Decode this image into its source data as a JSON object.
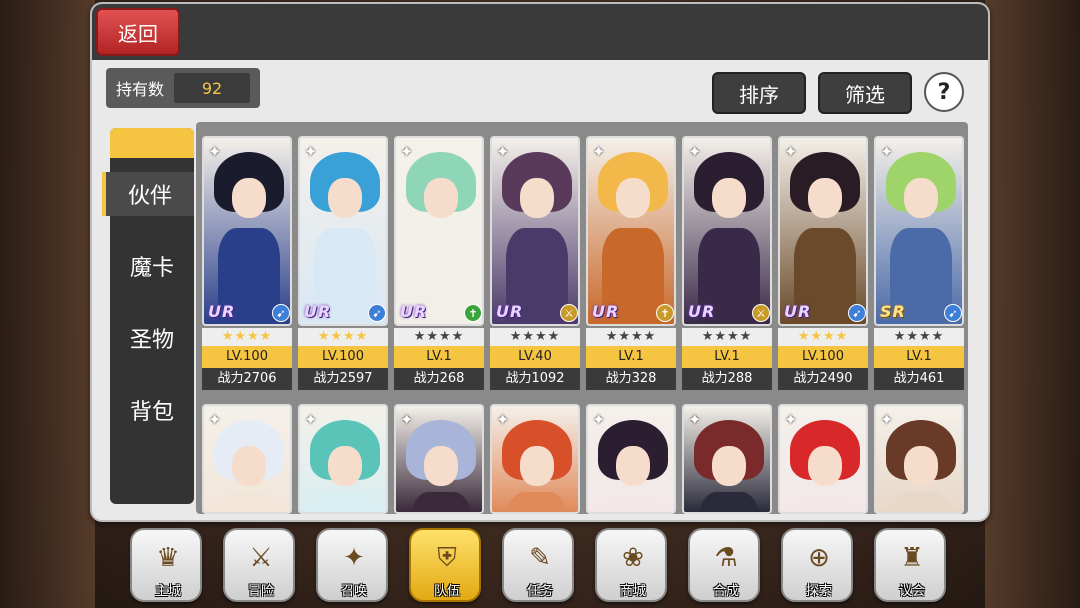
{
  "header": {
    "back_label": "返回"
  },
  "owned": {
    "label": "持有数",
    "value": "92"
  },
  "toolbar": {
    "sort_label": "排序",
    "filter_label": "筛选",
    "help_label": "?"
  },
  "sidebar": {
    "tabs": [
      {
        "label": "伙伴",
        "active": true
      },
      {
        "label": "魔卡",
        "active": false
      },
      {
        "label": "圣物",
        "active": false
      },
      {
        "label": "背包",
        "active": false
      }
    ]
  },
  "cards_row1": [
    {
      "rarity": "UR",
      "stars": "★★★★",
      "stars_color": "gold",
      "level": "LV.100",
      "power": "战力2706",
      "class_icon": "bow-icon",
      "class_color": "#3d7fd6",
      "hair": "#1b1b2e",
      "outfit": "#2a3f8a"
    },
    {
      "rarity": "UR",
      "stars": "★★★★",
      "stars_color": "gold",
      "level": "LV.100",
      "power": "战力2597",
      "class_icon": "bow-icon",
      "class_color": "#3d7fd6",
      "hair": "#3aa0d8",
      "outfit": "#d9e8f5"
    },
    {
      "rarity": "UR",
      "stars": "★★★★",
      "stars_color": "grey",
      "level": "LV.1",
      "power": "战力268",
      "class_icon": "cross-icon",
      "class_color": "#3aa53a",
      "hair": "#8fd6b8",
      "outfit": "#f2efe8"
    },
    {
      "rarity": "UR",
      "stars": "★★★★",
      "stars_color": "grey",
      "level": "LV.40",
      "power": "战力1092",
      "class_icon": "sword-icon",
      "class_color": "#c89a28",
      "hair": "#5a3a5a",
      "outfit": "#4a3a6a"
    },
    {
      "rarity": "UR",
      "stars": "★★★★",
      "stars_color": "grey",
      "level": "LV.1",
      "power": "战力328",
      "class_icon": "cross-icon",
      "class_color": "#c89a28",
      "hair": "#f2b84a",
      "outfit": "#c8682a"
    },
    {
      "rarity": "UR",
      "stars": "★★★★",
      "stars_color": "grey",
      "level": "LV.1",
      "power": "战力288",
      "class_icon": "sword-icon",
      "class_color": "#c89a28",
      "hair": "#2a1e30",
      "outfit": "#3a2a4a"
    },
    {
      "rarity": "UR",
      "stars": "★★★★",
      "stars_color": "gold",
      "level": "LV.100",
      "power": "战力2490",
      "class_icon": "bow-icon",
      "class_color": "#3d7fd6",
      "hair": "#2a1c24",
      "outfit": "#6a4a2a"
    },
    {
      "rarity": "SR",
      "stars": "★★★★",
      "stars_color": "grey",
      "level": "LV.1",
      "power": "战力461",
      "class_icon": "bow-icon",
      "class_color": "#3d7fd6",
      "hair": "#9ed46a",
      "outfit": "#4a6aa8"
    }
  ],
  "cards_row2": [
    {
      "hair": "#e6ecf5",
      "outfit": "#f2e6d8"
    },
    {
      "hair": "#5ac4b8",
      "outfit": "#d8eef0"
    },
    {
      "hair": "#a8b4d8",
      "outfit": "#3a2a3a"
    },
    {
      "hair": "#d8502a",
      "outfit": "#e08a5a"
    },
    {
      "hair": "#2a1e30",
      "outfit": "#f2e8e8"
    },
    {
      "hair": "#7a2a2a",
      "outfit": "#2a2a3a"
    },
    {
      "hair": "#d8282a",
      "outfit": "#f2e8e8"
    },
    {
      "hair": "#6a3a28",
      "outfit": "#e8d8c8"
    }
  ],
  "bottom_nav": [
    {
      "label": "主城",
      "icon": "crown-icon",
      "glyph": "♛",
      "active": false
    },
    {
      "label": "冒险",
      "icon": "swords-icon",
      "glyph": "⚔",
      "active": false
    },
    {
      "label": "召唤",
      "icon": "summon-card-icon",
      "glyph": "✦",
      "active": false
    },
    {
      "label": "队伍",
      "icon": "team-shield-icon",
      "glyph": "⛨",
      "active": true
    },
    {
      "label": "任务",
      "icon": "quest-book-icon",
      "glyph": "✎",
      "active": false
    },
    {
      "label": "商城",
      "icon": "shop-tree-icon",
      "glyph": "❀",
      "active": false
    },
    {
      "label": "合成",
      "icon": "potion-icon",
      "glyph": "⚗",
      "active": false
    },
    {
      "label": "探索",
      "icon": "telescope-icon",
      "glyph": "⊕",
      "active": false
    },
    {
      "label": "议会",
      "icon": "council-icon",
      "glyph": "♜",
      "active": false
    }
  ]
}
